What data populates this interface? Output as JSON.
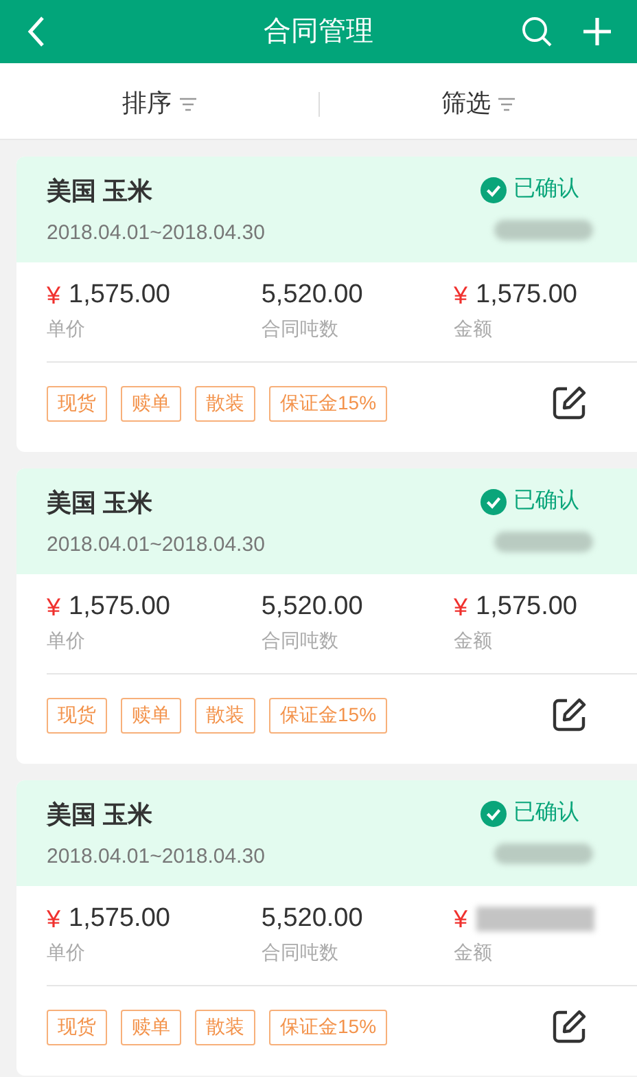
{
  "header": {
    "title": "合同管理"
  },
  "filters": [
    {
      "label": "排序"
    },
    {
      "label": "筛选"
    }
  ],
  "cards": [
    {
      "title": "美国 玉米",
      "period": "2018.04.01~2018.04.30",
      "status": "已确认",
      "metrics": [
        {
          "currency": "¥",
          "value": "1,575.00",
          "label": "单价",
          "blurred": false
        },
        {
          "value": "5,520.00",
          "label": "合同吨数",
          "blurred": false
        },
        {
          "currency": "¥",
          "value": "1,575.00",
          "label": "金额",
          "blurred": false
        }
      ],
      "tags": [
        "现货",
        "赎单",
        "散装",
        "保证金15%"
      ]
    },
    {
      "title": "美国 玉米",
      "period": "2018.04.01~2018.04.30",
      "status": "已确认",
      "metrics": [
        {
          "currency": "¥",
          "value": "1,575.00",
          "label": "单价",
          "blurred": false
        },
        {
          "value": "5,520.00",
          "label": "合同吨数",
          "blurred": false
        },
        {
          "currency": "¥",
          "value": "1,575.00",
          "label": "金额",
          "blurred": false
        }
      ],
      "tags": [
        "现货",
        "赎单",
        "散装",
        "保证金15%"
      ]
    },
    {
      "title": "美国 玉米",
      "period": "2018.04.01~2018.04.30",
      "status": "已确认",
      "metrics": [
        {
          "currency": "¥",
          "value": "1,575.00",
          "label": "单价",
          "blurred": false
        },
        {
          "value": "5,520.00",
          "label": "合同吨数",
          "blurred": false
        },
        {
          "currency": "¥",
          "label": "金额",
          "blurred": true
        }
      ],
      "tags": [
        "现货",
        "赎单",
        "散装",
        "保证金15%"
      ]
    }
  ]
}
